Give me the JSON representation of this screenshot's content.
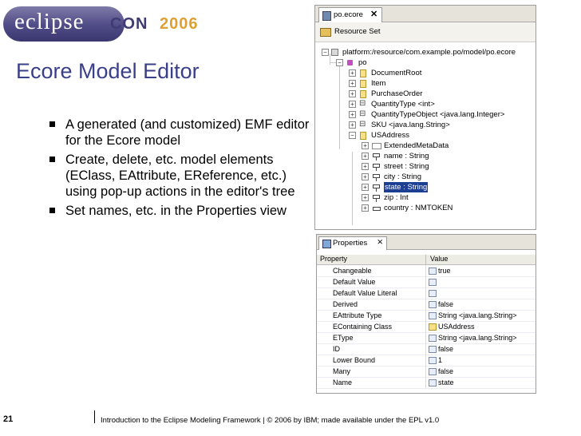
{
  "logo": {
    "word": "eclipse",
    "con": "CON",
    "year": "2006"
  },
  "slide": {
    "title": "Ecore Model Editor",
    "bullets": [
      "A generated (and customized) EMF editor for the Ecore model",
      "Create, delete, etc. model elements (EClass, EAttribute, EReference, etc.) using pop-up actions in the editor's tree",
      "Set names, etc. in the Properties view"
    ],
    "page_number": "21",
    "footer": "Introduction to the Eclipse Modeling Framework  |  © 2006 by IBM; made available under the EPL v1.0"
  },
  "editor": {
    "tab_label": "po.ecore",
    "close_glyph": "✕",
    "toolbar_label": "Resource Set",
    "tree": {
      "resource": "platform:/resource/com.example.po/model/po.ecore",
      "package": "po",
      "classes": [
        "DocumentRoot",
        "Item",
        "PurchaseOrder",
        "QuantityType <int>",
        "QuantityTypeObject <java.lang.Integer>",
        "SKU <java.lang.String>",
        "USAddress"
      ],
      "children": [
        "ExtendedMetaData",
        "name : String",
        "street : String",
        "city : String",
        "state : String",
        "zip : Int",
        "country : NMTOKEN"
      ],
      "selected": "state : String"
    }
  },
  "properties": {
    "tab_label": "Properties",
    "close_glyph": "⨯",
    "col_property": "Property",
    "col_value": "Value",
    "rows": [
      {
        "name": "Changeable",
        "value": "true"
      },
      {
        "name": "Default Value",
        "value": ""
      },
      {
        "name": "Default Value Literal",
        "value": ""
      },
      {
        "name": "Derived",
        "value": "false"
      },
      {
        "name": "EAttribute Type",
        "value": "String <java.lang.String>"
      },
      {
        "name": "EContaining Class",
        "value": "USAddress"
      },
      {
        "name": "EType",
        "value": "String <java.lang.String>"
      },
      {
        "name": "ID",
        "value": "false"
      },
      {
        "name": "Lower Bound",
        "value": "1"
      },
      {
        "name": "Many",
        "value": "false"
      },
      {
        "name": "Name",
        "value": "state"
      }
    ]
  },
  "colors": {
    "title": "#3a3f8a",
    "selection": "#1c3f94",
    "logo_purple": "#4f4b86",
    "logo_orange": "#e0a030"
  }
}
